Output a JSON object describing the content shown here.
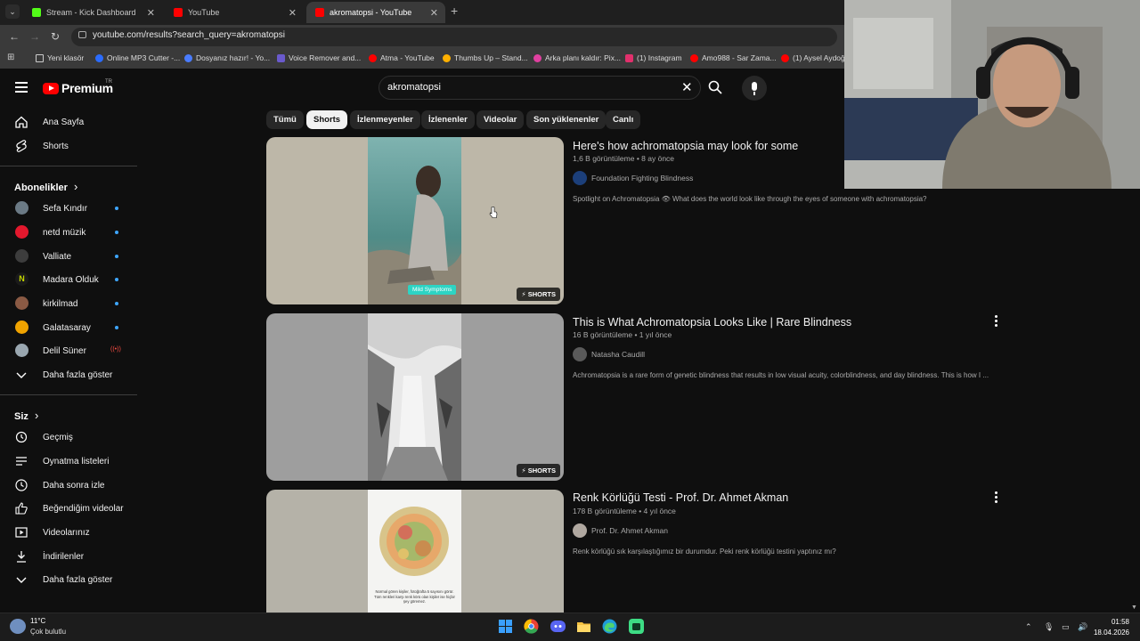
{
  "browser": {
    "tabs": [
      {
        "title": "Stream - Kick Dashboard",
        "color": "#53fc18"
      },
      {
        "title": "YouTube",
        "color": "#ff0000"
      },
      {
        "title": "akromatopsi - YouTube",
        "color": "#ff0000"
      }
    ],
    "url": "youtube.com/results?search_query=akromatopsi",
    "bookmarks": [
      {
        "label": "Yeni klasör",
        "color": "#cccccc"
      },
      {
        "label": "Online MP3 Cutter -...",
        "color": "#2b6cff"
      },
      {
        "label": "Dosyanız hazır! - Yo...",
        "color": "#4a7cff"
      },
      {
        "label": "Voice Remover and...",
        "color": "#6a5acd"
      },
      {
        "label": "Atma - YouTube",
        "color": "#ff0000"
      },
      {
        "label": "Thumbs Up – Stand...",
        "color": "#ffb000"
      },
      {
        "label": "Arka planı kaldır: Pix...",
        "color": "#e040a0"
      },
      {
        "label": "(1) Instagram",
        "color": "#e1306c"
      },
      {
        "label": "Amo988 - Sar Zama...",
        "color": "#ff0000"
      },
      {
        "label": "(1) Aysel Aydoğ",
        "color": "#ff0000"
      }
    ]
  },
  "youtube": {
    "logo_text": "Premium",
    "country": "TR",
    "search_value": "akromatopsi",
    "sidebar": {
      "main": [
        {
          "label": "Ana Sayfa"
        },
        {
          "label": "Shorts"
        }
      ],
      "subs_heading": "Abonelikler",
      "subs_arrow": "›",
      "subscriptions": [
        {
          "label": "Sefa Kındır",
          "color": "#6b7a85"
        },
        {
          "label": "netd müzik",
          "color": "#e3182d"
        },
        {
          "label": "Valliate",
          "color": "#3d3d3d"
        },
        {
          "label": "Madara Olduk",
          "color": "#c4d600"
        },
        {
          "label": "kirkilmad",
          "color": "#8a5a44"
        },
        {
          "label": "Galatasaray",
          "color": "#f0a300"
        },
        {
          "label": "Delil Süner",
          "color": "#9aa7b0"
        }
      ],
      "more_subs": "Daha fazla göster",
      "you_heading": "Siz",
      "you_arrow": "›",
      "you_items": [
        {
          "label": "Geçmiş"
        },
        {
          "label": "Oynatma listeleri"
        },
        {
          "label": "Daha sonra izle"
        },
        {
          "label": "Beğendiğim videolar"
        },
        {
          "label": "Videolarınız"
        },
        {
          "label": "İndirilenler"
        },
        {
          "label": "Daha fazla göster"
        }
      ]
    },
    "chips": [
      "Tümü",
      "Shorts",
      "İzlenmeyenler",
      "İzlenenler",
      "Videolar",
      "Son yüklenenler",
      "Canlı"
    ],
    "active_chip": "Shorts",
    "results": [
      {
        "title": "Here's how achromatopsia may look for some",
        "meta": "1,6 B görüntüleme • 8 ay önce",
        "channel": "Foundation Fighting Blindness",
        "description": "Spotlight on Achromatopsia 👁 What does the world look like through the eyes of someone with achromatopsia?",
        "badge": "SHORTS",
        "overlay": "Mild Symptoms"
      },
      {
        "title": "This is What Achromatopsia Looks Like | Rare Blindness",
        "meta": "16 B görüntüleme • 1 yıl önce",
        "channel": "Natasha Caudill",
        "description": "Achromatopsia is a rare form of genetic blindness that results in low visual acuity, colorblindness, and day blindness. This is how I ...",
        "badge": "SHORTS"
      },
      {
        "title": "Renk Körlüğü Testi - Prof. Dr. Ahmet Akman",
        "meta": "178 B görüntüleme • 4 yıl önce",
        "channel": "Prof. Dr. Ahmet Akman",
        "description": "Renk körlüğü sık karşılaştığımız bir durumdur. Peki renk körlüğü testini yaptınız mı?",
        "caption": "Normal gören kişiler, fotoğrafta 5 sayısını görür. Tüm renkleri karşı renk körü olan kişiler ise hiçbir şey göremez."
      }
    ]
  },
  "taskbar": {
    "temp": "11°C",
    "weather": "Çok bulutlu",
    "time": "01:58",
    "date": "18.04.2026"
  }
}
